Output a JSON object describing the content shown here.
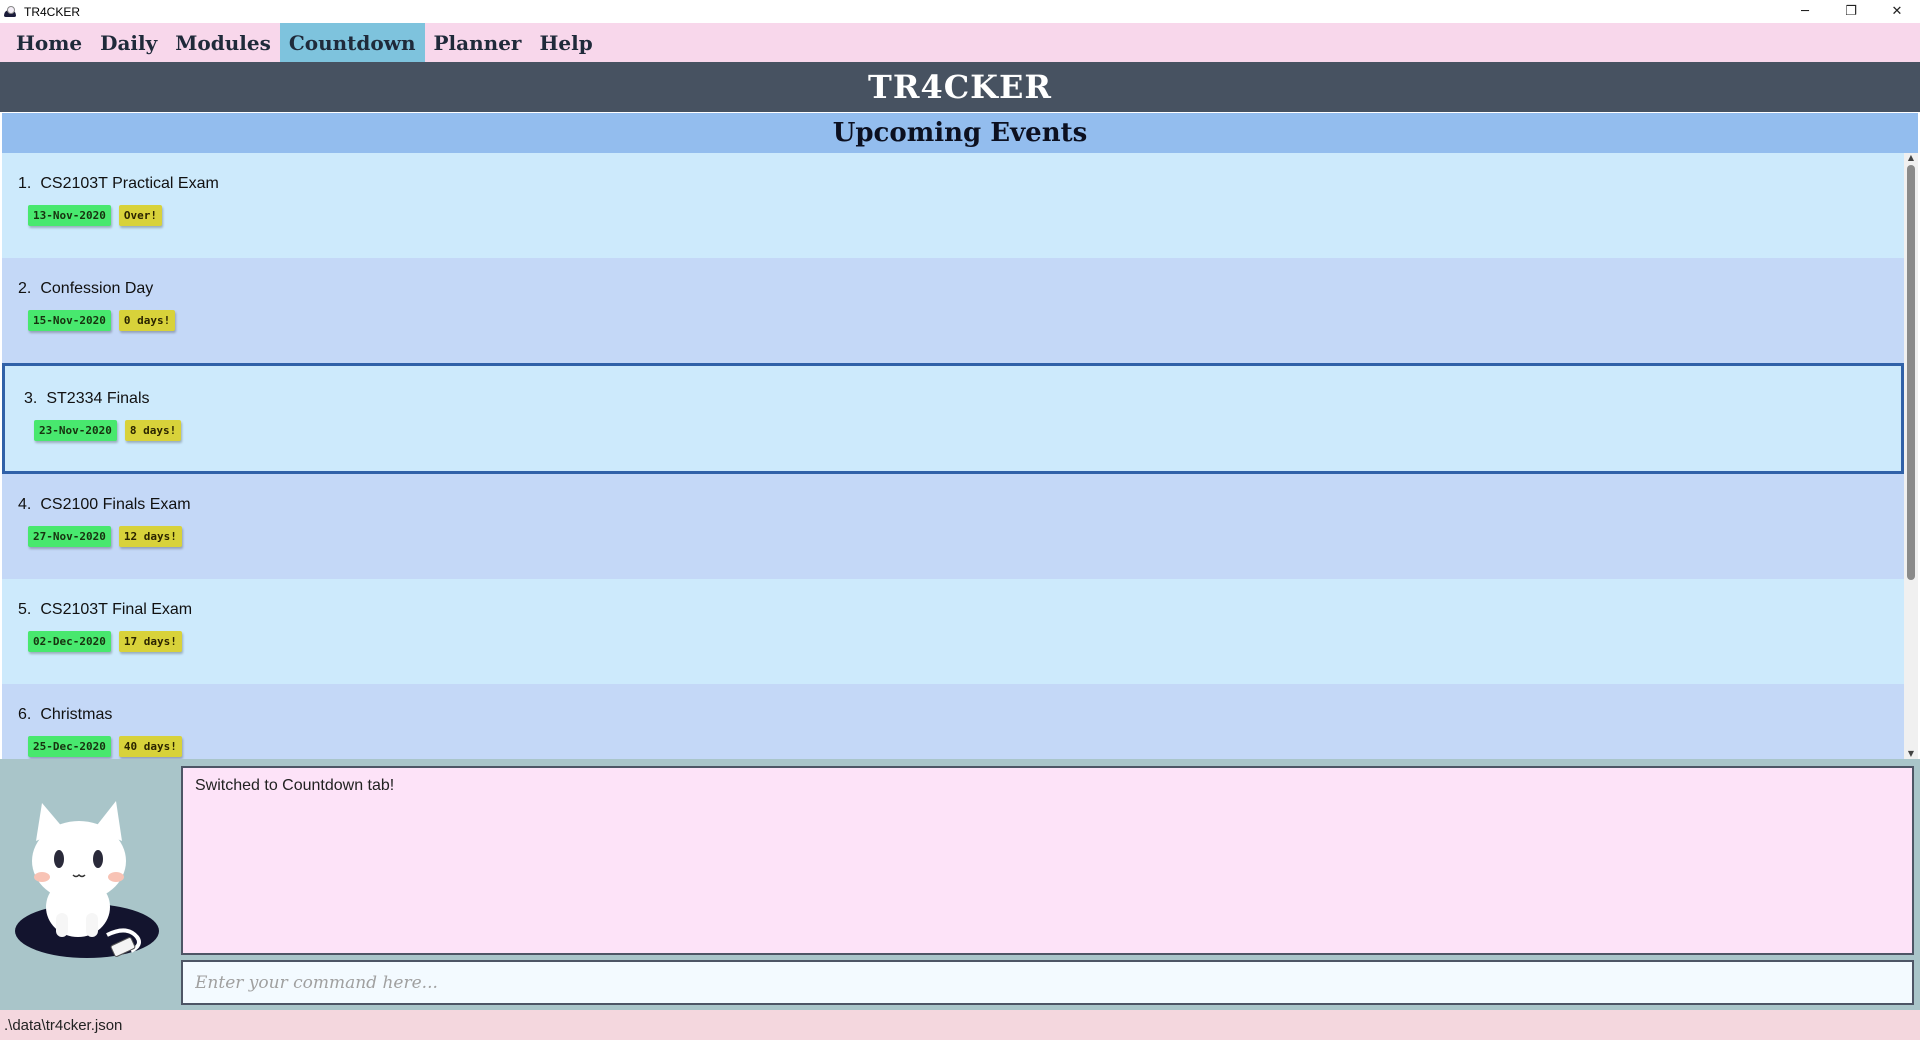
{
  "window": {
    "title": "TR4CKER",
    "controls": {
      "minimize": "─",
      "maximize": "❐",
      "close": "✕"
    }
  },
  "menu": {
    "items": [
      {
        "label": "Home",
        "active": false
      },
      {
        "label": "Daily",
        "active": false
      },
      {
        "label": "Modules",
        "active": false
      },
      {
        "label": "Countdown",
        "active": true
      },
      {
        "label": "Planner",
        "active": false
      },
      {
        "label": "Help",
        "active": false
      }
    ]
  },
  "header": {
    "title": "TR4CKER"
  },
  "section": {
    "title": "Upcoming Events"
  },
  "events": [
    {
      "index": "1.",
      "name": "CS2103T Practical Exam",
      "date": "13-Nov-2020",
      "countdown": "Over!"
    },
    {
      "index": "2.",
      "name": "Confession Day",
      "date": "15-Nov-2020",
      "countdown": "0 days!"
    },
    {
      "index": "3.",
      "name": "ST2334 Finals",
      "date": "23-Nov-2020",
      "countdown": "8 days!",
      "selected": true
    },
    {
      "index": "4.",
      "name": "CS2100 Finals Exam",
      "date": "27-Nov-2020",
      "countdown": "12 days!"
    },
    {
      "index": "5.",
      "name": "CS2103T Final Exam",
      "date": "02-Dec-2020",
      "countdown": "17 days!"
    },
    {
      "index": "6.",
      "name": "Christmas",
      "date": "25-Dec-2020",
      "countdown": "40 days!"
    }
  ],
  "result": {
    "text": "Switched to Countdown tab!"
  },
  "command": {
    "placeholder": "Enter your command here...",
    "value": ""
  },
  "status": {
    "path": ".\\data\\tr4cker.json"
  },
  "colors": {
    "menubar": "#f8d7eb",
    "active_tab": "#7ec3dd",
    "header": "#475261",
    "section_title": "#93bdee",
    "row_odd": "#cdeafc",
    "row_even": "#c4d8f7",
    "date_tag": "#48e86e",
    "countdown_tag": "#d8d23a",
    "result_bg": "#fde3f8",
    "status_bg": "#f4d7de"
  },
  "icons": {
    "app": "cat-icon",
    "mascot": "cat-mascot"
  }
}
